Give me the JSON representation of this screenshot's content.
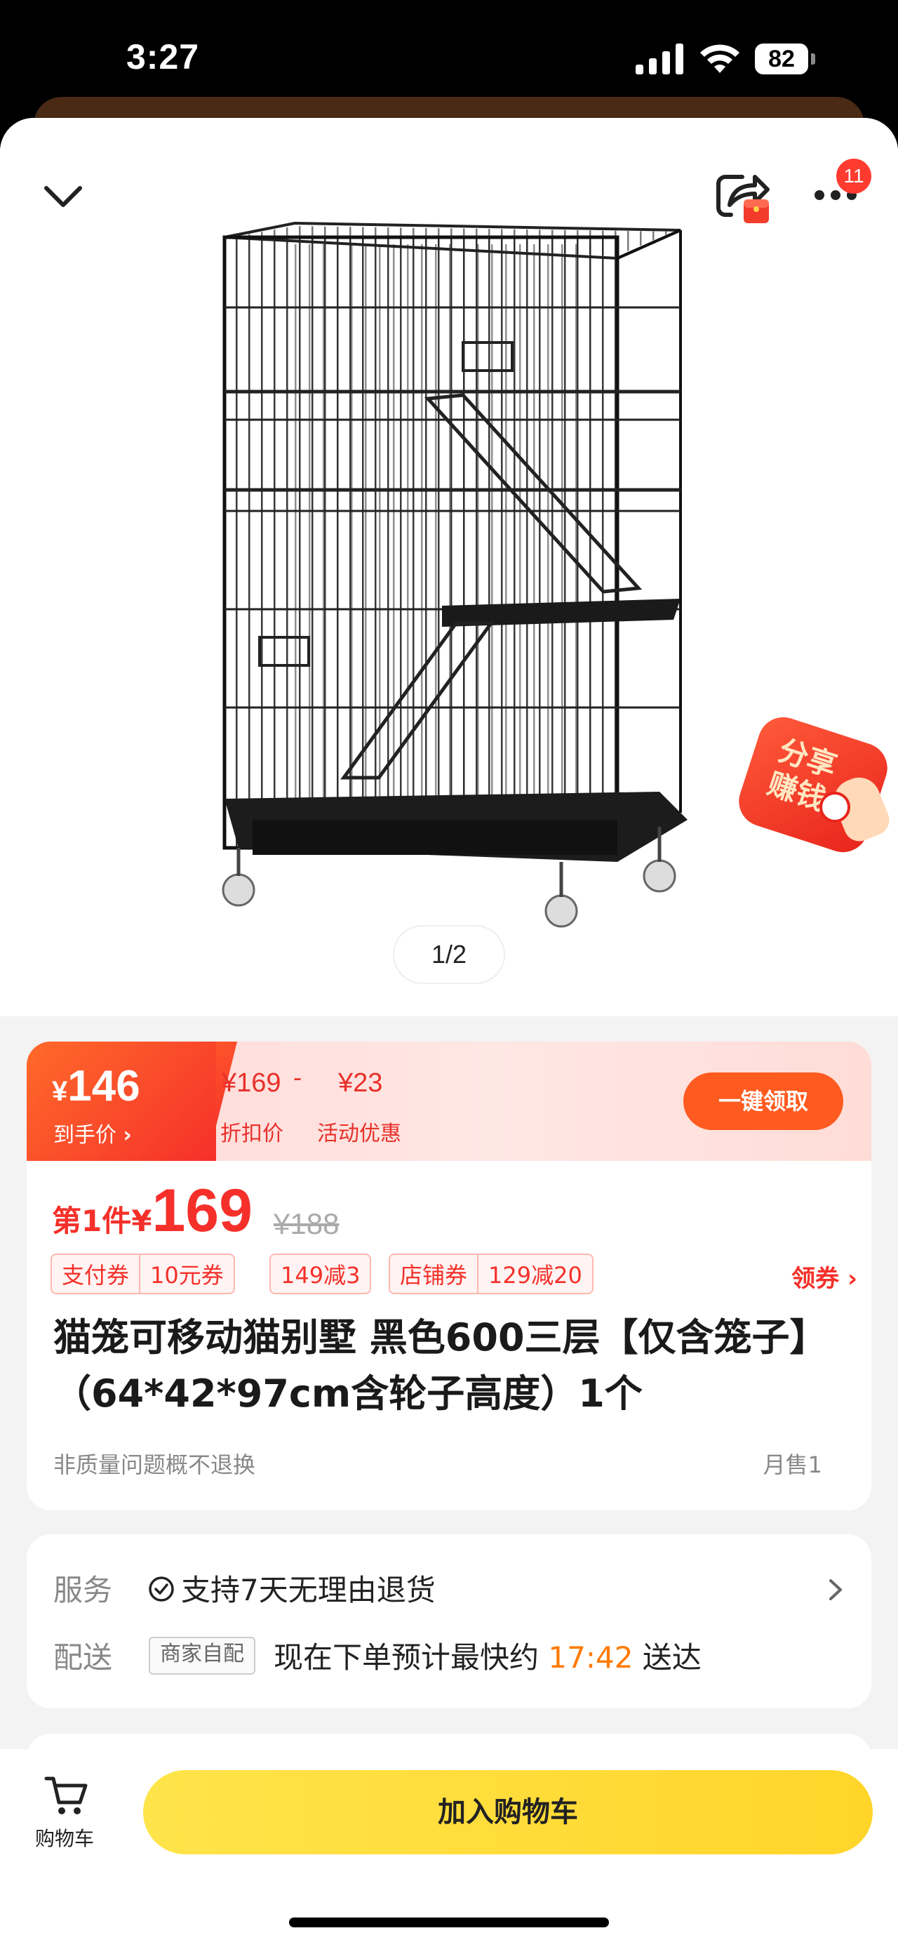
{
  "status_bar": {
    "time": "3:27",
    "battery": "82"
  },
  "header": {
    "notification_count": "11"
  },
  "gallery": {
    "page_indicator": "1/2",
    "share_earn_line1": "分享",
    "share_earn_line2": "赚钱"
  },
  "price_banner": {
    "final_currency": "¥",
    "final_price": "146",
    "final_label": "到手价",
    "discount_price": "¥169",
    "minus": "-",
    "promo_amount": "¥23",
    "discount_label": "折扣价",
    "promo_label": "活动优惠",
    "claim_button": "一键领取"
  },
  "pricing": {
    "first_piece_label": "第1件",
    "currency": "¥",
    "price": "169",
    "original_price": "¥188",
    "tags": [
      {
        "left": "支付券",
        "right": "10元券"
      },
      {
        "single": "149减3"
      },
      {
        "left": "店铺券",
        "right": "129减20"
      }
    ],
    "get_coupon": "领券"
  },
  "product": {
    "title": "猫笼可移动猫别墅 黑色600三层【仅含笼子】（64*42*97cm含轮子高度）1个",
    "return_note": "非质量问题概不退换",
    "monthly_sales": "月售1"
  },
  "service": {
    "service_label": "服务",
    "service_text": "支持7天无理由退货",
    "delivery_label": "配送",
    "merchant_tag": "商家自配",
    "delivery_prefix": "现在下单预计最快约",
    "delivery_time": "17:42",
    "delivery_suffix": "送达"
  },
  "bottom_bar": {
    "cart_label": "购物车",
    "add_to_cart": "加入购物车"
  },
  "colors": {
    "accent_red": "#f5302a",
    "orange": "#ff5a1f",
    "yellow": "#ffd52a",
    "eta_orange": "#ff7a00"
  }
}
